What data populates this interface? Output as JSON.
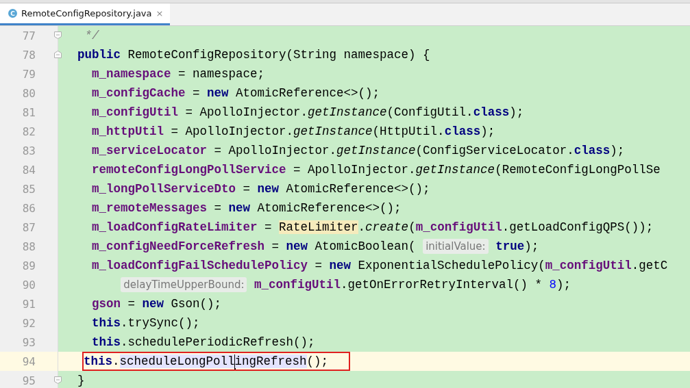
{
  "tab": {
    "icon_letter": "C",
    "label": "RemoteConfigRepository.java",
    "close": "×",
    "selected": true
  },
  "lines": [
    {
      "number": "77",
      "fold_end": true,
      "tokens": [
        {
          "kind": "comment",
          "text": "   */"
        }
      ]
    },
    {
      "number": "78",
      "fold_start": true,
      "tokens": [
        {
          "kind": "kw",
          "text": "  public"
        },
        {
          "kind": "text",
          "text": " RemoteConfigRepository(String namespace) {"
        }
      ]
    },
    {
      "number": "79",
      "tokens": [
        {
          "kind": "field",
          "text": "    m_namespace"
        },
        {
          "kind": "text",
          "text": " = namespace;"
        }
      ]
    },
    {
      "number": "80",
      "tokens": [
        {
          "kind": "field",
          "text": "    m_configCache"
        },
        {
          "kind": "text",
          "text": " = "
        },
        {
          "kind": "kw",
          "text": "new"
        },
        {
          "kind": "text",
          "text": " AtomicReference<>();"
        }
      ]
    },
    {
      "number": "81",
      "tokens": [
        {
          "kind": "field",
          "text": "    m_configUtil"
        },
        {
          "kind": "text",
          "text": " = ApolloInjector."
        },
        {
          "kind": "static",
          "text": "getInstance"
        },
        {
          "kind": "text",
          "text": "(ConfigUtil."
        },
        {
          "kind": "kw",
          "text": "class"
        },
        {
          "kind": "text",
          "text": ");"
        }
      ]
    },
    {
      "number": "82",
      "tokens": [
        {
          "kind": "field",
          "text": "    m_httpUtil"
        },
        {
          "kind": "text",
          "text": " = ApolloInjector."
        },
        {
          "kind": "static",
          "text": "getInstance"
        },
        {
          "kind": "text",
          "text": "(HttpUtil."
        },
        {
          "kind": "kw",
          "text": "class"
        },
        {
          "kind": "text",
          "text": ");"
        }
      ]
    },
    {
      "number": "83",
      "tokens": [
        {
          "kind": "field",
          "text": "    m_serviceLocator"
        },
        {
          "kind": "text",
          "text": " = ApolloInjector."
        },
        {
          "kind": "static",
          "text": "getInstance"
        },
        {
          "kind": "text",
          "text": "(ConfigServiceLocator."
        },
        {
          "kind": "kw",
          "text": "class"
        },
        {
          "kind": "text",
          "text": ");"
        }
      ]
    },
    {
      "number": "84",
      "tokens": [
        {
          "kind": "field",
          "text": "    remoteConfigLongPollService"
        },
        {
          "kind": "text",
          "text": " = ApolloInjector."
        },
        {
          "kind": "static",
          "text": "getInstance"
        },
        {
          "kind": "text",
          "text": "(RemoteConfigLongPollSe"
        }
      ]
    },
    {
      "number": "85",
      "tokens": [
        {
          "kind": "field",
          "text": "    m_longPollServiceDto"
        },
        {
          "kind": "text",
          "text": " = "
        },
        {
          "kind": "kw",
          "text": "new"
        },
        {
          "kind": "text",
          "text": " AtomicReference<>();"
        }
      ]
    },
    {
      "number": "86",
      "tokens": [
        {
          "kind": "field",
          "text": "    m_remoteMessages"
        },
        {
          "kind": "text",
          "text": " = "
        },
        {
          "kind": "kw",
          "text": "new"
        },
        {
          "kind": "text",
          "text": " AtomicReference<>();"
        }
      ]
    },
    {
      "number": "87",
      "tokens": [
        {
          "kind": "field",
          "text": "    m_loadConfigRateLimiter"
        },
        {
          "kind": "text",
          "text": " = "
        },
        {
          "kind": "ref",
          "text": "RateLimiter"
        },
        {
          "kind": "text",
          "text": "."
        },
        {
          "kind": "static",
          "text": "create"
        },
        {
          "kind": "text",
          "text": "("
        },
        {
          "kind": "field",
          "text": "m_configUtil"
        },
        {
          "kind": "text",
          "text": ".getLoadConfigQPS());"
        }
      ]
    },
    {
      "number": "88",
      "tokens": [
        {
          "kind": "field",
          "text": "    m_configNeedForceRefresh"
        },
        {
          "kind": "text",
          "text": " = "
        },
        {
          "kind": "kw",
          "text": "new"
        },
        {
          "kind": "text",
          "text": " AtomicBoolean( "
        },
        {
          "kind": "hint",
          "text": "initialValue:"
        },
        {
          "kind": "kw",
          "text": " true"
        },
        {
          "kind": "text",
          "text": ");"
        }
      ]
    },
    {
      "number": "89",
      "tokens": [
        {
          "kind": "field",
          "text": "    m_loadConfigFailSchedulePolicy"
        },
        {
          "kind": "text",
          "text": " = "
        },
        {
          "kind": "kw",
          "text": "new"
        },
        {
          "kind": "text",
          "text": " ExponentialSchedulePolicy("
        },
        {
          "kind": "field",
          "text": "m_configUtil"
        },
        {
          "kind": "text",
          "text": ".getC"
        }
      ]
    },
    {
      "number": "90",
      "continuation": true,
      "tokens": [
        {
          "kind": "hint",
          "text": "delayTimeUpperBound:"
        },
        {
          "kind": "field",
          "text": " m_configUtil"
        },
        {
          "kind": "text",
          "text": ".getOnErrorRetryInterval() * "
        },
        {
          "kind": "num",
          "text": "8"
        },
        {
          "kind": "text",
          "text": ");"
        }
      ]
    },
    {
      "number": "91",
      "tokens": [
        {
          "kind": "field",
          "text": "    gson"
        },
        {
          "kind": "text",
          "text": " = "
        },
        {
          "kind": "kw",
          "text": "new"
        },
        {
          "kind": "text",
          "text": " Gson();"
        }
      ]
    },
    {
      "number": "92",
      "tokens": [
        {
          "kind": "kw",
          "text": "    this"
        },
        {
          "kind": "text",
          "text": ".trySync();"
        }
      ]
    },
    {
      "number": "93",
      "tokens": [
        {
          "kind": "kw",
          "text": "    this"
        },
        {
          "kind": "text",
          "text": ".schedulePeriodicRefresh();"
        }
      ]
    },
    {
      "number": "94",
      "current": true,
      "boxed": true,
      "tokens": [
        {
          "kind": "kw",
          "text": "    this"
        },
        {
          "kind": "text",
          "text": "."
        },
        {
          "kind": "usage",
          "text": "scheduleLongPoll",
          "caret": true
        },
        {
          "kind": "usage",
          "text": "ingRefresh"
        },
        {
          "kind": "text",
          "text": "();"
        }
      ]
    },
    {
      "number": "95",
      "fold_end": true,
      "tokens": [
        {
          "kind": "text",
          "text": "  }"
        }
      ]
    }
  ]
}
